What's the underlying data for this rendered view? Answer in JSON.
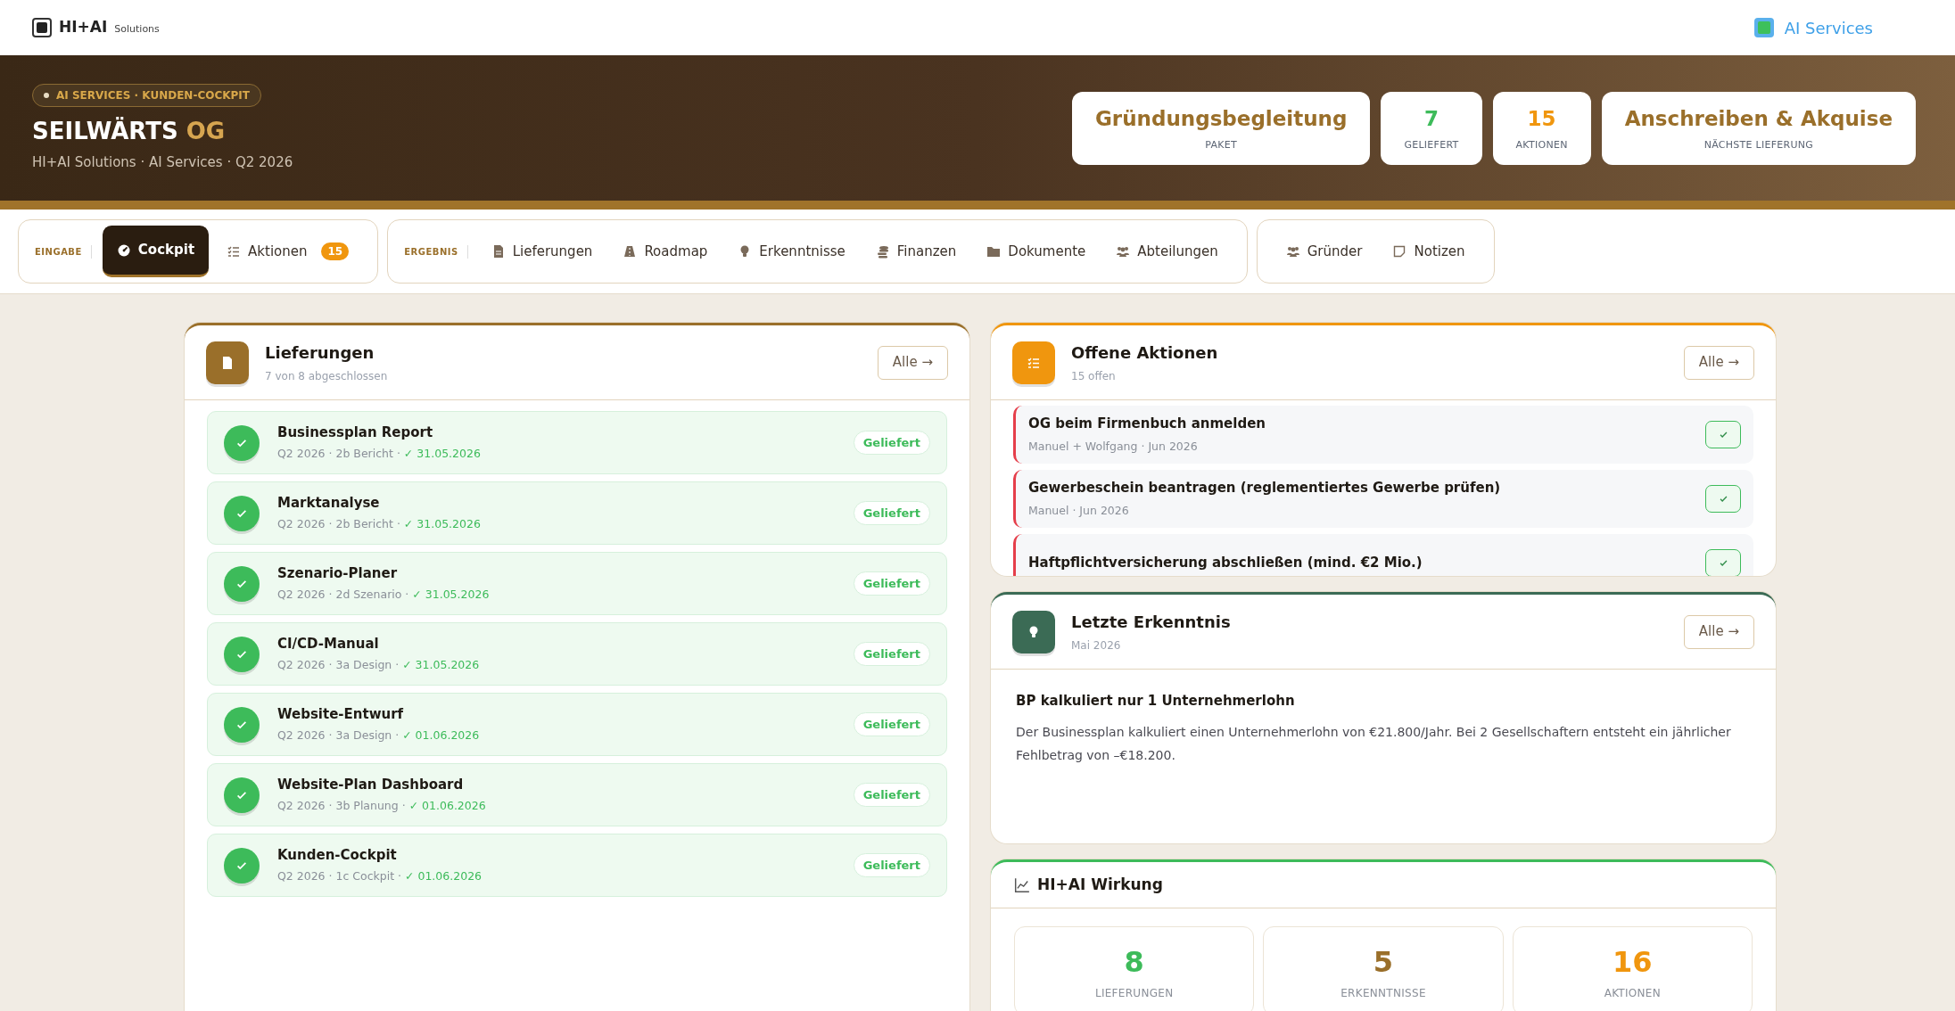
{
  "topbar": {
    "logo": "HI+AI",
    "logo_sub": "Solutions",
    "link": "AI Services"
  },
  "hero": {
    "eyebrow": "AI SERVICES · KUNDEN-COCKPIT",
    "title": "SEILWÄRTS",
    "title_accent": "OG",
    "subtitle": "HI+AI Solutions · AI Services · Q2 2026",
    "stats": [
      {
        "value": "Gründungsbegleitung",
        "label": "PAKET",
        "color": "#9a6f2a"
      },
      {
        "value": "7",
        "label": "GELIEFERT",
        "color": "#3dbb5a"
      },
      {
        "value": "15",
        "label": "AKTIONEN",
        "color": "#f0960e"
      },
      {
        "value": "Anschreiben & Akquise",
        "label": "NÄCHSTE LIEFERUNG",
        "color": "#9a6f2a"
      }
    ]
  },
  "nav": [
    {
      "label": "EINGABE",
      "items": [
        {
          "label": "Cockpit",
          "selected": true
        },
        {
          "label": "Aktionen",
          "badge": "15",
          "selected": false
        }
      ]
    },
    {
      "label": "ERGEBNIS",
      "items": [
        {
          "label": "Lieferungen",
          "selected": false
        },
        {
          "label": "Roadmap",
          "selected": false
        },
        {
          "label": "Erkenntnisse",
          "selected": false
        },
        {
          "label": "Finanzen",
          "selected": false
        },
        {
          "label": "Dokumente",
          "selected": false
        },
        {
          "label": "Abteilungen",
          "selected": false
        }
      ]
    },
    {
      "items": [
        {
          "label": "Gründer",
          "selected": false
        },
        {
          "label": "Notizen",
          "selected": false
        }
      ]
    }
  ],
  "deliveries": {
    "title": "Lieferungen",
    "subtitle": "7 von 8 abgeschlossen",
    "button": "Alle →",
    "items": [
      {
        "title": "Businessplan Report",
        "meta": "Q2 2026 · 2b Bericht · ",
        "date": "✓ 31.05.2026",
        "status": "Geliefert"
      },
      {
        "title": "Marktanalyse",
        "meta": "Q2 2026 · 2b Bericht · ",
        "date": "✓ 31.05.2026",
        "status": "Geliefert"
      },
      {
        "title": "Szenario-Planer",
        "meta": "Q2 2026 · 2d Szenario · ",
        "date": "✓ 31.05.2026",
        "status": "Geliefert"
      },
      {
        "title": "CI/CD-Manual",
        "meta": "Q2 2026 · 3a Design · ",
        "date": "✓ 31.05.2026",
        "status": "Geliefert"
      },
      {
        "title": "Website-Entwurf",
        "meta": "Q2 2026 · 3a Design · ",
        "date": "✓ 01.06.2026",
        "status": "Geliefert"
      },
      {
        "title": "Website-Plan Dashboard",
        "meta": "Q2 2026 · 3b Planung · ",
        "date": "✓ 01.06.2026",
        "status": "Geliefert"
      },
      {
        "title": "Kunden-Cockpit",
        "meta": "Q2 2026 · 1c Cockpit · ",
        "date": "✓ 01.06.2026",
        "status": "Geliefert"
      }
    ]
  },
  "actions": {
    "title": "Offene Aktionen",
    "subtitle": "15 offen",
    "button": "Alle →",
    "items": [
      {
        "title": "OG beim Firmenbuch anmelden",
        "meta": "Manuel + Wolfgang · Jun 2026",
        "color": "#e53e4a"
      },
      {
        "title": "Gewerbeschein beantragen (reglementiertes Gewerbe prüfen)",
        "meta": "Manuel · Jun 2026",
        "color": "#e53e4a"
      },
      {
        "title": "Haftpflichtversicherung abschließen (mind. €2 Mio.)",
        "color": "#e53e4a"
      }
    ]
  },
  "insight": {
    "title": "Letzte Erkenntnis",
    "subtitle": "Mai 2026",
    "button": "Alle →",
    "heading": "BP kalkuliert nur 1 Unternehmerlohn",
    "text": "Der Businessplan kalkuliert einen Unternehmerlohn von €21.800/Jahr. Bei 2 Gesellschaftern entsteht ein jährlicher Fehlbetrag von –€18.200."
  },
  "impact": {
    "title": "HI+AI Wirkung",
    "stats": [
      {
        "value": "8",
        "label": "LIEFERUNGEN",
        "color": "#3dbb5a"
      },
      {
        "value": "5",
        "label": "ERKENNTNISSE",
        "color": "#9a6f2a"
      },
      {
        "value": "16",
        "label": "AKTIONEN",
        "color": "#f0960e"
      }
    ]
  }
}
